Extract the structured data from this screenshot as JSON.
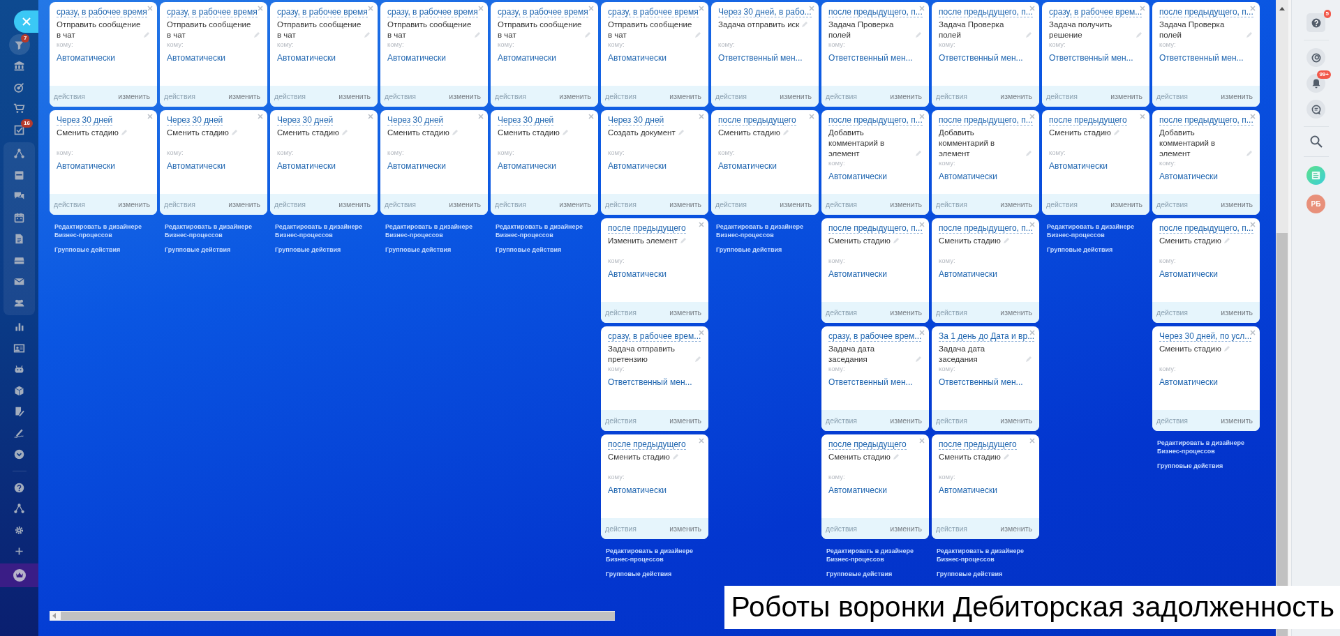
{
  "sidebar": {
    "filter_badge": "7",
    "tasks_badge": "16"
  },
  "columns": [
    {
      "robots": [
        {
          "trigger": "сразу, в рабочее время",
          "title": "Отправить сообщение в чат",
          "recipient_label": "кому:",
          "recipient": "Автоматически",
          "actions": "действия",
          "edit": "изменить"
        },
        {
          "trigger": "Через 30 дней",
          "title": "Сменить стадию",
          "recipient_label": "кому:",
          "recipient": "Автоматически",
          "actions": "действия",
          "edit": "изменить"
        }
      ],
      "designer_link": "Редактировать в дизайнере Бизнес-процессов",
      "group_actions": "Групповые действия"
    },
    {
      "robots": [
        {
          "trigger": "сразу, в рабочее время",
          "title": "Отправить сообщение в чат",
          "recipient_label": "кому:",
          "recipient": "Автоматически",
          "actions": "действия",
          "edit": "изменить"
        },
        {
          "trigger": "Через 30 дней",
          "title": "Сменить стадию",
          "recipient_label": "кому:",
          "recipient": "Автоматически",
          "actions": "действия",
          "edit": "изменить"
        }
      ],
      "designer_link": "Редактировать в дизайнере Бизнес-процессов",
      "group_actions": "Групповые действия"
    },
    {
      "robots": [
        {
          "trigger": "сразу, в рабочее время",
          "title": "Отправить сообщение в чат",
          "recipient_label": "кому:",
          "recipient": "Автоматически",
          "actions": "действия",
          "edit": "изменить"
        },
        {
          "trigger": "Через 30 дней",
          "title": "Сменить стадию",
          "recipient_label": "кому:",
          "recipient": "Автоматически",
          "actions": "действия",
          "edit": "изменить"
        }
      ],
      "designer_link": "Редактировать в дизайнере Бизнес-процессов",
      "group_actions": "Групповые действия"
    },
    {
      "robots": [
        {
          "trigger": "сразу, в рабочее время",
          "title": "Отправить сообщение в чат",
          "recipient_label": "кому:",
          "recipient": "Автоматически",
          "actions": "действия",
          "edit": "изменить"
        },
        {
          "trigger": "Через 30 дней",
          "title": "Сменить стадию",
          "recipient_label": "кому:",
          "recipient": "Автоматически",
          "actions": "действия",
          "edit": "изменить"
        }
      ],
      "designer_link": "Редактировать в дизайнере Бизнес-процессов",
      "group_actions": "Групповые действия"
    },
    {
      "robots": [
        {
          "trigger": "сразу, в рабочее время",
          "title": "Отправить сообщение в чат",
          "recipient_label": "кому:",
          "recipient": "Автоматически",
          "actions": "действия",
          "edit": "изменить"
        },
        {
          "trigger": "Через 30 дней",
          "title": "Сменить стадию",
          "recipient_label": "кому:",
          "recipient": "Автоматически",
          "actions": "действия",
          "edit": "изменить"
        }
      ],
      "designer_link": "Редактировать в дизайнере Бизнес-процессов",
      "group_actions": "Групповые действия"
    },
    {
      "robots": [
        {
          "trigger": "сразу, в рабочее время",
          "title": "Отправить сообщение в чат",
          "recipient_label": "кому:",
          "recipient": "Автоматически",
          "actions": "действия",
          "edit": "изменить"
        },
        {
          "trigger": "Через 30 дней",
          "title": "Создать документ",
          "recipient_label": "кому:",
          "recipient": "Автоматически",
          "actions": "действия",
          "edit": "изменить"
        },
        {
          "trigger": "после предыдущего",
          "title": "Изменить элемент",
          "recipient_label": "кому:",
          "recipient": "Автоматически",
          "actions": "действия",
          "edit": "изменить"
        },
        {
          "trigger": "сразу, в рабочее врем...",
          "title": "Задача отправить претензию",
          "recipient_label": "кому:",
          "recipient": "Ответственный мен...",
          "actions": "действия",
          "edit": "изменить"
        },
        {
          "trigger": "после предыдущего",
          "title": "Сменить стадию",
          "recipient_label": "кому:",
          "recipient": "Автоматически",
          "actions": "действия",
          "edit": "изменить"
        }
      ],
      "designer_link": "Редактировать в дизайнере Бизнес-процессов",
      "group_actions": "Групповые действия"
    },
    {
      "robots": [
        {
          "trigger": "Через 30 дней, в рабо...",
          "title": "Задача отправить иск",
          "recipient_label": "кому:",
          "recipient": "Ответственный мен...",
          "actions": "действия",
          "edit": "изменить"
        },
        {
          "trigger": "после предыдущего",
          "title": "Сменить стадию",
          "recipient_label": "кому:",
          "recipient": "Автоматически",
          "actions": "действия",
          "edit": "изменить"
        }
      ],
      "designer_link": "Редактировать в дизайнере Бизнес-процессов",
      "group_actions": "Групповые действия"
    },
    {
      "robots": [
        {
          "trigger": "после предыдущего, п...",
          "title": "Задача Проверка полей",
          "recipient_label": "кому:",
          "recipient": "Ответственный мен...",
          "actions": "действия",
          "edit": "изменить"
        },
        {
          "trigger": "после предыдущего, п...",
          "title": "Добавить комментарий в элемент",
          "recipient_label": "кому:",
          "recipient": "Автоматически",
          "actions": "действия",
          "edit": "изменить"
        },
        {
          "trigger": "после предыдущего, п...",
          "title": "Сменить стадию",
          "recipient_label": "кому:",
          "recipient": "Автоматически",
          "actions": "действия",
          "edit": "изменить"
        },
        {
          "trigger": "сразу, в рабочее врем...",
          "title": "Задача дата заседания",
          "recipient_label": "кому:",
          "recipient": "Ответственный мен...",
          "actions": "действия",
          "edit": "изменить"
        },
        {
          "trigger": "после предыдущего",
          "title": "Сменить стадию",
          "recipient_label": "кому:",
          "recipient": "Автоматически",
          "actions": "действия",
          "edit": "изменить"
        }
      ],
      "designer_link": "Редактировать в дизайнере Бизнес-процессов",
      "group_actions": "Групповые действия"
    },
    {
      "robots": [
        {
          "trigger": "после предыдущего, п...",
          "title": "Задача Проверка полей",
          "recipient_label": "кому:",
          "recipient": "Ответственный мен...",
          "actions": "действия",
          "edit": "изменить"
        },
        {
          "trigger": "после предыдущего, п...",
          "title": "Добавить комментарий в элемент",
          "recipient_label": "кому:",
          "recipient": "Автоматически",
          "actions": "действия",
          "edit": "изменить"
        },
        {
          "trigger": "после предыдущего, п...",
          "title": "Сменить стадию",
          "recipient_label": "кому:",
          "recipient": "Автоматически",
          "actions": "действия",
          "edit": "изменить"
        },
        {
          "trigger": "За 1 день до Дата и вр...",
          "title": "Задача дата заседания",
          "recipient_label": "кому:",
          "recipient": "Ответственный мен...",
          "actions": "действия",
          "edit": "изменить"
        },
        {
          "trigger": "после предыдущего",
          "title": "Сменить стадию",
          "recipient_label": "кому:",
          "recipient": "Автоматически",
          "actions": "действия",
          "edit": "изменить"
        }
      ],
      "designer_link": "Редактировать в дизайнере Бизнес-процессов",
      "group_actions": "Групповые действия"
    },
    {
      "robots": [
        {
          "trigger": "сразу, в рабочее врем...",
          "title": "Задача получить решение",
          "recipient_label": "кому:",
          "recipient": "Ответственный мен...",
          "actions": "действия",
          "edit": "изменить"
        },
        {
          "trigger": "после предыдущего",
          "title": "Сменить стадию",
          "recipient_label": "кому:",
          "recipient": "Автоматически",
          "actions": "действия",
          "edit": "изменить"
        }
      ],
      "designer_link": "Редактировать в дизайнере Бизнес-процессов",
      "group_actions": "Групповые действия"
    },
    {
      "robots": [
        {
          "trigger": "после предыдущего, п...",
          "title": "Задача Проверка полей",
          "recipient_label": "кому:",
          "recipient": "Ответственный мен...",
          "actions": "действия",
          "edit": "изменить"
        },
        {
          "trigger": "после предыдущего, п...",
          "title": "Добавить комментарий в элемент",
          "recipient_label": "кому:",
          "recipient": "Автоматически",
          "actions": "действия",
          "edit": "изменить"
        },
        {
          "trigger": "после предыдущего, п...",
          "title": "Сменить стадию",
          "recipient_label": "кому:",
          "recipient": "Автоматически",
          "actions": "действия",
          "edit": "изменить"
        },
        {
          "trigger": "Через 30 дней, по усл...",
          "title": "Сменить стадию",
          "recipient_label": "кому:",
          "recipient": "Автоматически",
          "actions": "действия",
          "edit": "изменить"
        }
      ],
      "designer_link": "Редактировать в дизайнере Бизнес-процессов",
      "group_actions": "Групповые действия"
    }
  ],
  "right_panel": {
    "help_badge": "5",
    "notifications_badge": "99+",
    "avatar_initials": "РБ"
  },
  "caption": "Роботы воронки Дебиторская задолженность"
}
